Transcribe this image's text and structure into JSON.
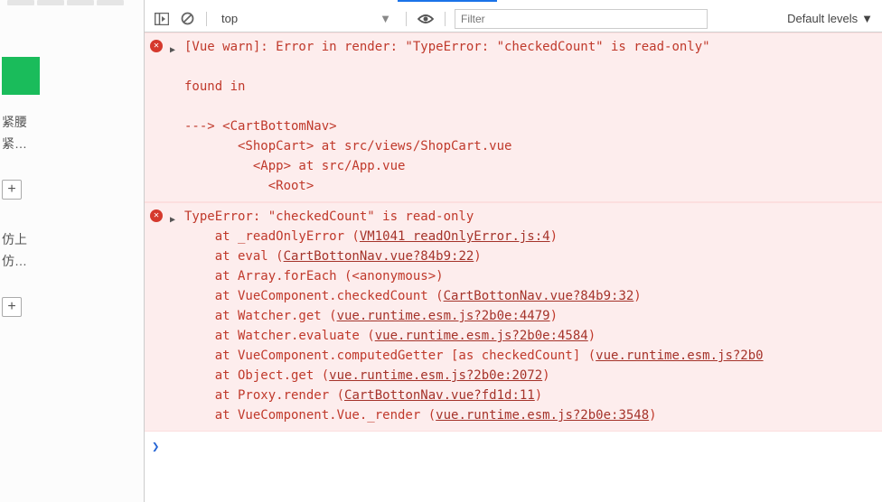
{
  "left": {
    "texts": [
      "紧腰",
      "紧…",
      "仿上",
      "仿…"
    ]
  },
  "toolbar": {
    "context": "top",
    "filter_placeholder": "Filter",
    "levels": "Default levels"
  },
  "errors": [
    {
      "line1": "[Vue warn]: Error in render: \"TypeError: \"checkedCount\" is read-only\"",
      "blank1": "",
      "found": "found in",
      "blank2": "",
      "l1": "---> <CartBottomNav>",
      "l2": "       <ShopCart> at src/views/ShopCart.vue",
      "l3": "         <App> at src/App.vue",
      "l4": "           <Root>"
    },
    {
      "head": "TypeError: \"checkedCount\" is read-only",
      "t1a": "    at _readOnlyError (",
      "t1u": "VM1041 readOnlyError.js:4",
      "t1b": ")",
      "t2a": "    at eval (",
      "t2u": "CartBottonNav.vue?84b9:22",
      "t2b": ")",
      "t3": "    at Array.forEach (<anonymous>)",
      "t4a": "    at VueComponent.checkedCount (",
      "t4u": "CartBottonNav.vue?84b9:32",
      "t4b": ")",
      "t5a": "    at Watcher.get (",
      "t5u": "vue.runtime.esm.js?2b0e:4479",
      "t5b": ")",
      "t6a": "    at Watcher.evaluate (",
      "t6u": "vue.runtime.esm.js?2b0e:4584",
      "t6b": ")",
      "t7a": "    at VueComponent.computedGetter [as checkedCount] (",
      "t7u": "vue.runtime.esm.js?2b0",
      "t7b": "",
      "t8a": "    at Object.get (",
      "t8u": "vue.runtime.esm.js?2b0e:2072",
      "t8b": ")",
      "t9a": "    at Proxy.render (",
      "t9u": "CartBottonNav.vue?fd1d:11",
      "t9b": ")",
      "t10a": "    at VueComponent.Vue._render (",
      "t10u": "vue.runtime.esm.js?2b0e:3548",
      "t10b": ")"
    }
  ],
  "prompt": "❯"
}
